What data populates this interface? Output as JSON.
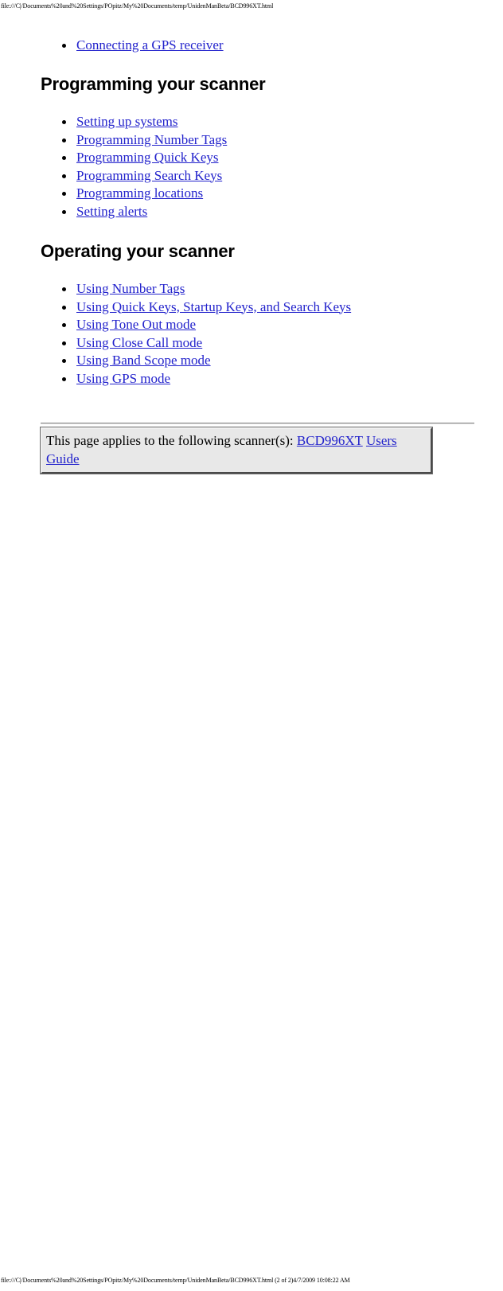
{
  "page": {
    "header_path": "file:///C|/Documents%20and%20Settings/POpitz/My%20Documents/temp/UnidenManBeta/BCD996XT.html",
    "footer_path": "file:///C|/Documents%20and%20Settings/POpitz/My%20Documents/temp/UnidenManBeta/BCD996XT.html (2 of 2)4/7/2009 10:08:22 AM"
  },
  "colors": {
    "link": "#2222cc",
    "text": "#000000",
    "note_background": "#e8e8e8",
    "rule": "#999999"
  },
  "top_list": {
    "items": [
      {
        "label": "Connecting a GPS receiver"
      }
    ]
  },
  "sections": [
    {
      "heading": "Programming your scanner",
      "items": [
        {
          "label": "Setting up systems"
        },
        {
          "label": "Programming Number Tags"
        },
        {
          "label": "Programming Quick Keys"
        },
        {
          "label": "Programming Search Keys"
        },
        {
          "label": "Programming locations"
        },
        {
          "label": "Setting alerts"
        }
      ]
    },
    {
      "heading": "Operating your scanner",
      "items": [
        {
          "label": "Using Number Tags"
        },
        {
          "label": "Using Quick Keys, Startup Keys, and Search Keys"
        },
        {
          "label": "Using Tone Out mode"
        },
        {
          "label": "Using Close Call mode"
        },
        {
          "label": "Using Band Scope mode"
        },
        {
          "label": "Using GPS mode"
        }
      ]
    }
  ],
  "note": {
    "prefix": "This page applies to the following scanner(s): ",
    "link_model": "BCD996XT",
    "separator": " ",
    "link_guide": "Users Guide"
  }
}
